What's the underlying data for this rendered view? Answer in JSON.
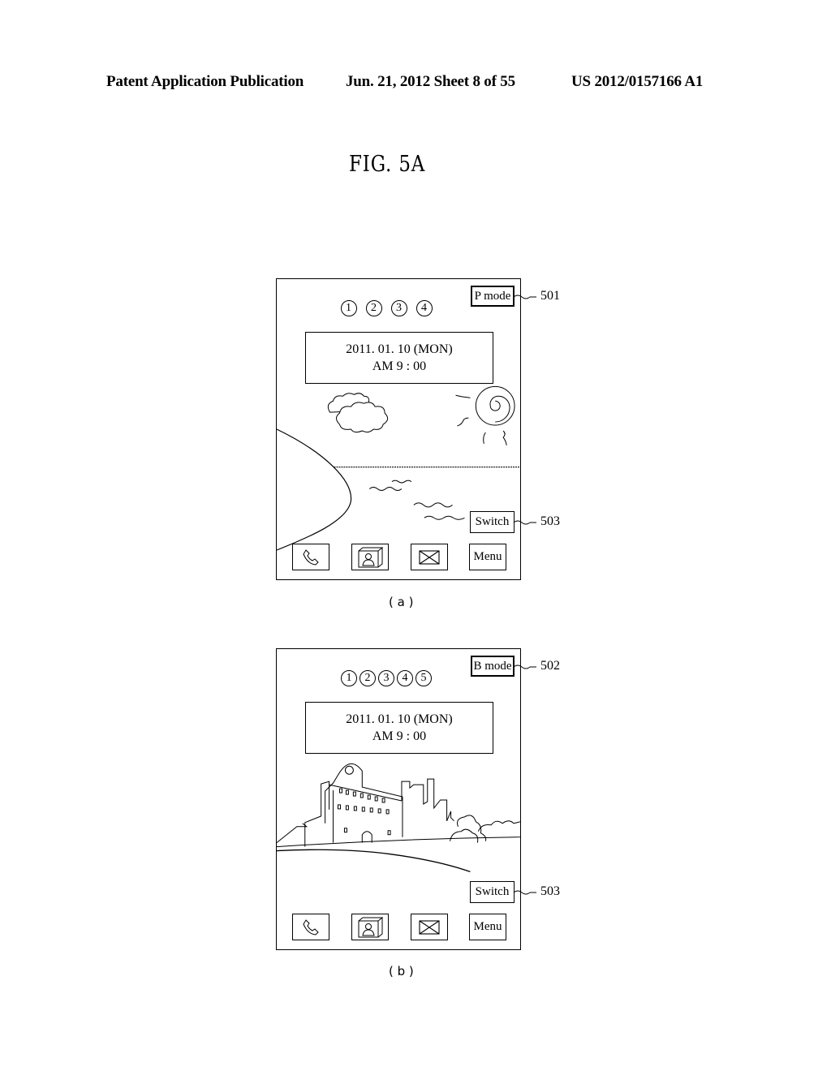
{
  "header": {
    "left": "Patent Application Publication",
    "center": "Jun. 21, 2012  Sheet 8 of 55",
    "right": "US 2012/0157166 A1"
  },
  "figure": {
    "title": "FIG. 5A"
  },
  "panels": [
    {
      "label": "( a )",
      "mode_button": "P mode",
      "mode_ref": "501",
      "page_indicators": [
        "1",
        "2",
        "3",
        "4"
      ],
      "clock": {
        "date": "2011. 01. 10 (MON)",
        "time": "AM 9 : 00"
      },
      "switch_button": "Switch",
      "switch_ref": "503",
      "dock": [
        {
          "icon": "phone-icon"
        },
        {
          "icon": "contacts-icon"
        },
        {
          "icon": "mail-icon"
        },
        {
          "label": "Menu"
        }
      ],
      "background": "beach-scene"
    },
    {
      "label": "( b )",
      "mode_button": "B mode",
      "mode_ref": "502",
      "page_indicators": [
        "1",
        "2",
        "3",
        "4",
        "5"
      ],
      "clock": {
        "date": "2011. 01. 10 (MON)",
        "time": "AM 9 : 00"
      },
      "switch_button": "Switch",
      "switch_ref": "503",
      "dock": [
        {
          "icon": "phone-icon"
        },
        {
          "icon": "contacts-icon"
        },
        {
          "icon": "mail-icon"
        },
        {
          "label": "Menu"
        }
      ],
      "background": "castle-scene"
    }
  ]
}
